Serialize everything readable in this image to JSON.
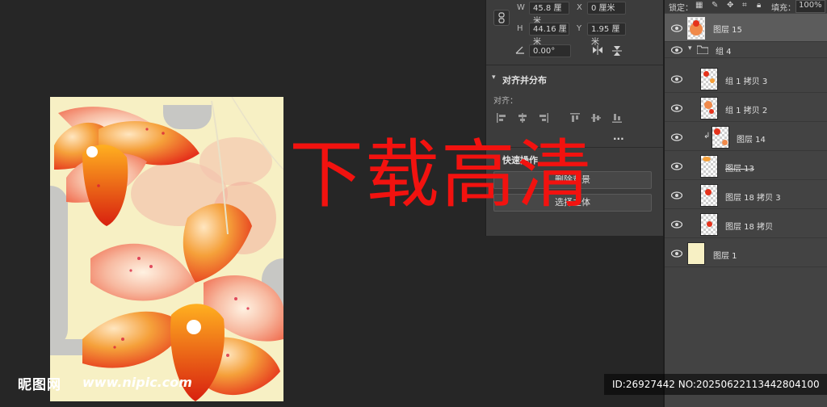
{
  "properties": {
    "w_label": "W",
    "w_value": "45.8 厘米",
    "h_label": "H",
    "h_value": "44.16 厘米",
    "x_label": "X",
    "x_value": "0 厘米",
    "y_label": "Y",
    "y_value": "1.95 厘米",
    "angle_value": "0.00°",
    "align_section_title": "对齐并分布",
    "align_label": "对齐：",
    "more_label": "...",
    "quick_actions_title": "快速操作",
    "remove_bg_label": "删除背景",
    "select_subject_label": "选择主体"
  },
  "layers_toolbar": {
    "lock_label": "锁定：",
    "fill_label": "填充：",
    "fill_value": "100%"
  },
  "layers": [
    {
      "name": "图层 15",
      "selected": true
    },
    {
      "name": "组 4",
      "group": true
    },
    {
      "name": "组 1 拷贝 3"
    },
    {
      "name": "组 1 拷贝 2"
    },
    {
      "name": "图层 14"
    },
    {
      "name": "图层 13"
    },
    {
      "name": "图层 18 拷贝 3"
    },
    {
      "name": "图层 18 拷贝"
    },
    {
      "name": "图层 1"
    }
  ],
  "overlay": {
    "big_watermark": "下载高清",
    "site_logo": "昵图网",
    "site_url": "www.nipic.com",
    "id_text": "ID:26927442 NO:20250622113442804100"
  },
  "colors": {
    "watermark_red": "#f2120f",
    "canvas_bg": "#f7f0c4",
    "flower_red": "#e5321c",
    "flower_orange": "#f5a03a"
  }
}
